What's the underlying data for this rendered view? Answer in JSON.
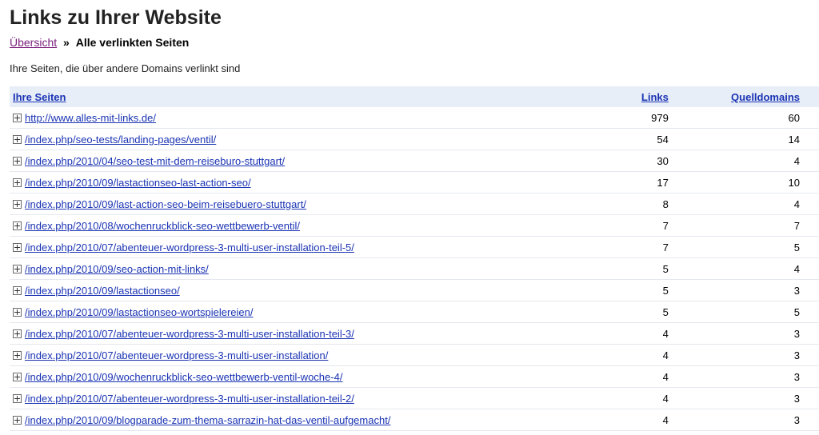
{
  "page": {
    "title": "Links zu Ihrer Website",
    "description": "Ihre Seiten, die über andere Domains verlinkt sind"
  },
  "breadcrumb": {
    "link": "Übersicht",
    "separator": "»",
    "current": "Alle verlinkten Seiten"
  },
  "table": {
    "headers": {
      "pages": "Ihre Seiten",
      "links": "Links",
      "domains": "Quelldomains"
    },
    "rows": [
      {
        "url": "http://www.alles-mit-links.de/",
        "links": "979",
        "domains": "60"
      },
      {
        "url": "/index.php/seo-tests/landing-pages/ventil/",
        "links": "54",
        "domains": "14"
      },
      {
        "url": "/index.php/2010/04/seo-test-mit-dem-reiseburo-stuttgart/",
        "links": "30",
        "domains": "4"
      },
      {
        "url": "/index.php/2010/09/lastactionseo-last-action-seo/",
        "links": "17",
        "domains": "10"
      },
      {
        "url": "/index.php/2010/09/last-action-seo-beim-reisebuero-stuttgart/",
        "links": "8",
        "domains": "4"
      },
      {
        "url": "/index.php/2010/08/wochenruckblick-seo-wettbewerb-ventil/",
        "links": "7",
        "domains": "7"
      },
      {
        "url": "/index.php/2010/07/abenteuer-wordpress-3-multi-user-installation-teil-5/",
        "links": "7",
        "domains": "5"
      },
      {
        "url": "/index.php/2010/09/seo-action-mit-links/",
        "links": "5",
        "domains": "4"
      },
      {
        "url": "/index.php/2010/09/lastactionseo/",
        "links": "5",
        "domains": "3"
      },
      {
        "url": "/index.php/2010/09/lastactionseo-wortspielereien/",
        "links": "5",
        "domains": "5"
      },
      {
        "url": "/index.php/2010/07/abenteuer-wordpress-3-multi-user-installation-teil-3/",
        "links": "4",
        "domains": "3"
      },
      {
        "url": "/index.php/2010/07/abenteuer-wordpress-3-multi-user-installation/",
        "links": "4",
        "domains": "3"
      },
      {
        "url": "/index.php/2010/09/wochenruckblick-seo-wettbewerb-ventil-woche-4/",
        "links": "4",
        "domains": "3"
      },
      {
        "url": "/index.php/2010/07/abenteuer-wordpress-3-multi-user-installation-teil-2/",
        "links": "4",
        "domains": "3"
      },
      {
        "url": "/index.php/2010/09/blogparade-zum-thema-sarrazin-hat-das-ventil-aufgemacht/",
        "links": "4",
        "domains": "3"
      }
    ]
  },
  "icons": {
    "row_expand": "plus-box-icon"
  },
  "colors": {
    "link": "#1a33b3",
    "visited_link": "#7a1e7a",
    "header_bg": "#e8eef7"
  }
}
